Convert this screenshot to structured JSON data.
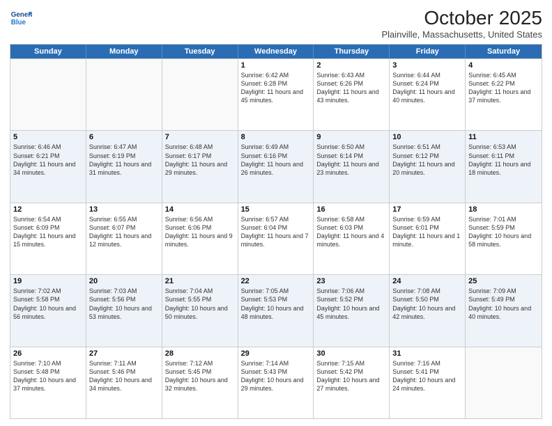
{
  "logo": {
    "line1": "General",
    "line2": "Blue"
  },
  "header": {
    "month": "October 2025",
    "location": "Plainville, Massachusetts, United States"
  },
  "days_of_week": [
    "Sunday",
    "Monday",
    "Tuesday",
    "Wednesday",
    "Thursday",
    "Friday",
    "Saturday"
  ],
  "weeks": [
    [
      {
        "day": "",
        "empty": true
      },
      {
        "day": "",
        "empty": true
      },
      {
        "day": "",
        "empty": true
      },
      {
        "day": "1",
        "info": "Sunrise: 6:42 AM\nSunset: 6:28 PM\nDaylight: 11 hours\nand 45 minutes."
      },
      {
        "day": "2",
        "info": "Sunrise: 6:43 AM\nSunset: 6:26 PM\nDaylight: 11 hours\nand 43 minutes."
      },
      {
        "day": "3",
        "info": "Sunrise: 6:44 AM\nSunset: 6:24 PM\nDaylight: 11 hours\nand 40 minutes."
      },
      {
        "day": "4",
        "info": "Sunrise: 6:45 AM\nSunset: 6:22 PM\nDaylight: 11 hours\nand 37 minutes."
      }
    ],
    [
      {
        "day": "5",
        "info": "Sunrise: 6:46 AM\nSunset: 6:21 PM\nDaylight: 11 hours\nand 34 minutes."
      },
      {
        "day": "6",
        "info": "Sunrise: 6:47 AM\nSunset: 6:19 PM\nDaylight: 11 hours\nand 31 minutes."
      },
      {
        "day": "7",
        "info": "Sunrise: 6:48 AM\nSunset: 6:17 PM\nDaylight: 11 hours\nand 29 minutes."
      },
      {
        "day": "8",
        "info": "Sunrise: 6:49 AM\nSunset: 6:16 PM\nDaylight: 11 hours\nand 26 minutes."
      },
      {
        "day": "9",
        "info": "Sunrise: 6:50 AM\nSunset: 6:14 PM\nDaylight: 11 hours\nand 23 minutes."
      },
      {
        "day": "10",
        "info": "Sunrise: 6:51 AM\nSunset: 6:12 PM\nDaylight: 11 hours\nand 20 minutes."
      },
      {
        "day": "11",
        "info": "Sunrise: 6:53 AM\nSunset: 6:11 PM\nDaylight: 11 hours\nand 18 minutes."
      }
    ],
    [
      {
        "day": "12",
        "info": "Sunrise: 6:54 AM\nSunset: 6:09 PM\nDaylight: 11 hours\nand 15 minutes."
      },
      {
        "day": "13",
        "info": "Sunrise: 6:55 AM\nSunset: 6:07 PM\nDaylight: 11 hours\nand 12 minutes."
      },
      {
        "day": "14",
        "info": "Sunrise: 6:56 AM\nSunset: 6:06 PM\nDaylight: 11 hours\nand 9 minutes."
      },
      {
        "day": "15",
        "info": "Sunrise: 6:57 AM\nSunset: 6:04 PM\nDaylight: 11 hours\nand 7 minutes."
      },
      {
        "day": "16",
        "info": "Sunrise: 6:58 AM\nSunset: 6:03 PM\nDaylight: 11 hours\nand 4 minutes."
      },
      {
        "day": "17",
        "info": "Sunrise: 6:59 AM\nSunset: 6:01 PM\nDaylight: 11 hours\nand 1 minute."
      },
      {
        "day": "18",
        "info": "Sunrise: 7:01 AM\nSunset: 5:59 PM\nDaylight: 10 hours\nand 58 minutes."
      }
    ],
    [
      {
        "day": "19",
        "info": "Sunrise: 7:02 AM\nSunset: 5:58 PM\nDaylight: 10 hours\nand 56 minutes."
      },
      {
        "day": "20",
        "info": "Sunrise: 7:03 AM\nSunset: 5:56 PM\nDaylight: 10 hours\nand 53 minutes."
      },
      {
        "day": "21",
        "info": "Sunrise: 7:04 AM\nSunset: 5:55 PM\nDaylight: 10 hours\nand 50 minutes."
      },
      {
        "day": "22",
        "info": "Sunrise: 7:05 AM\nSunset: 5:53 PM\nDaylight: 10 hours\nand 48 minutes."
      },
      {
        "day": "23",
        "info": "Sunrise: 7:06 AM\nSunset: 5:52 PM\nDaylight: 10 hours\nand 45 minutes."
      },
      {
        "day": "24",
        "info": "Sunrise: 7:08 AM\nSunset: 5:50 PM\nDaylight: 10 hours\nand 42 minutes."
      },
      {
        "day": "25",
        "info": "Sunrise: 7:09 AM\nSunset: 5:49 PM\nDaylight: 10 hours\nand 40 minutes."
      }
    ],
    [
      {
        "day": "26",
        "info": "Sunrise: 7:10 AM\nSunset: 5:48 PM\nDaylight: 10 hours\nand 37 minutes."
      },
      {
        "day": "27",
        "info": "Sunrise: 7:11 AM\nSunset: 5:46 PM\nDaylight: 10 hours\nand 34 minutes."
      },
      {
        "day": "28",
        "info": "Sunrise: 7:12 AM\nSunset: 5:45 PM\nDaylight: 10 hours\nand 32 minutes."
      },
      {
        "day": "29",
        "info": "Sunrise: 7:14 AM\nSunset: 5:43 PM\nDaylight: 10 hours\nand 29 minutes."
      },
      {
        "day": "30",
        "info": "Sunrise: 7:15 AM\nSunset: 5:42 PM\nDaylight: 10 hours\nand 27 minutes."
      },
      {
        "day": "31",
        "info": "Sunrise: 7:16 AM\nSunset: 5:41 PM\nDaylight: 10 hours\nand 24 minutes."
      },
      {
        "day": "",
        "empty": true
      }
    ]
  ]
}
